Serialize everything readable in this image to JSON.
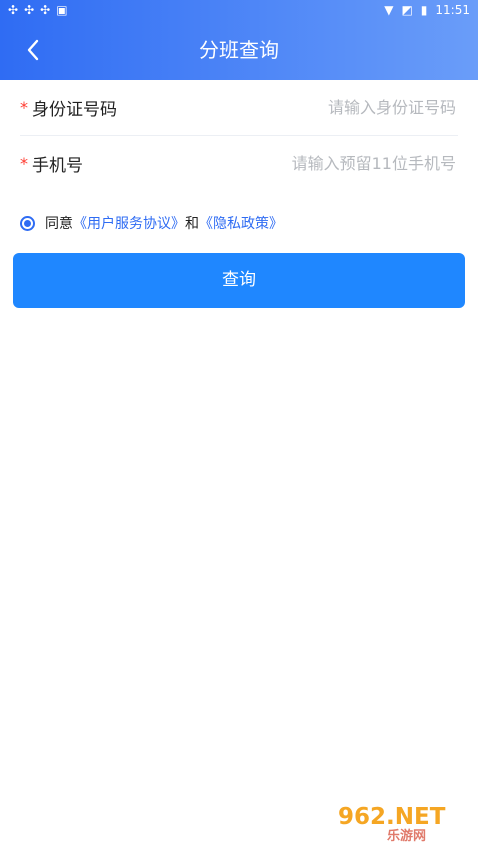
{
  "statusbar": {
    "left_icons": [
      "bug-icon",
      "bug-icon",
      "bug-icon",
      "a-icon"
    ],
    "time": "11:51"
  },
  "header": {
    "title": "分班查询",
    "back_icon": "chevron-left-icon",
    "gradient_colors": [
      "#2f6cf3",
      "#6a9df9"
    ]
  },
  "form": {
    "fields": [
      {
        "label": "身份证号码",
        "placeholder": "请输入身份证号码",
        "required_mark": "*"
      },
      {
        "label": "手机号",
        "placeholder": "请输入预留11位手机号",
        "required_mark": "*"
      }
    ]
  },
  "agreement": {
    "prefix": "同意",
    "user_agreement": "《用户服务协议》",
    "and": "和",
    "privacy_policy": "《隐私政策》",
    "checked": true
  },
  "button": {
    "label": "查询",
    "color": "#1f87ff"
  },
  "watermark": {
    "text1": "962.NET",
    "text2": "乐游网"
  }
}
